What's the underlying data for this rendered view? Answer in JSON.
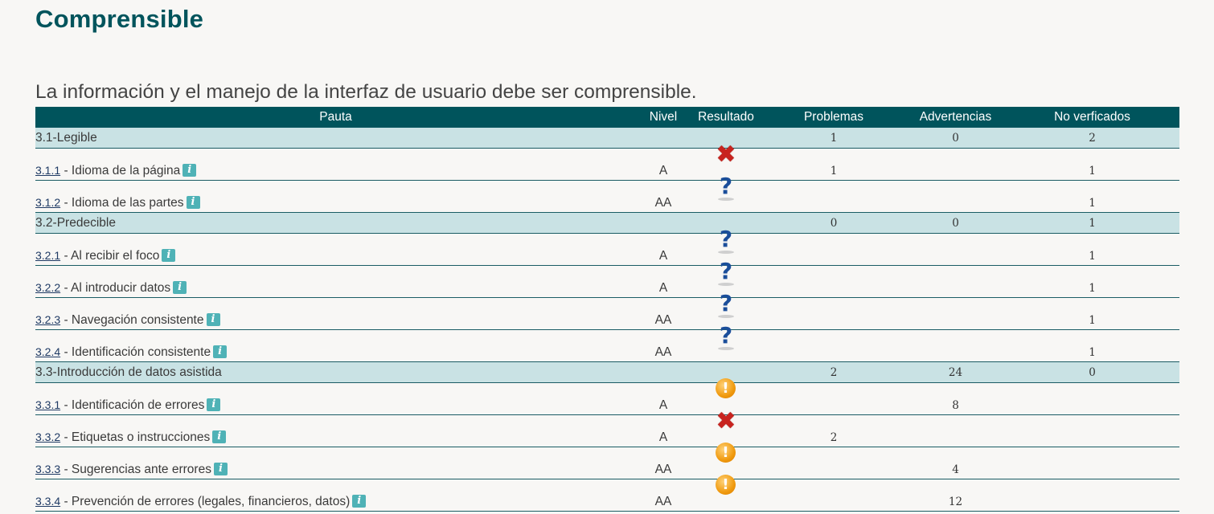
{
  "section_title": "Comprensible",
  "section_description": "La información y el manejo de la interfaz de usuario debe ser comprensible.",
  "table": {
    "headers": {
      "pauta": "Pauta",
      "nivel": "Nivel",
      "resultado": "Resultado",
      "problemas": "Problemas",
      "advertencias": "Advertencias",
      "no_verificados": "No verficados"
    },
    "groups": [
      {
        "label": "3.1-Legible",
        "problemas": "1",
        "advertencias": "0",
        "no_verificados": "2",
        "items": [
          {
            "code": "3.1.1",
            "label": " - Idioma de la página",
            "nivel": "A",
            "result_icon": "fail",
            "problemas": "1",
            "advertencias": "",
            "no_verificados": "1"
          },
          {
            "code": "3.1.2",
            "label": " - Idioma de las partes",
            "nivel": "AA",
            "result_icon": "unknown",
            "problemas": "",
            "advertencias": "",
            "no_verificados": "1"
          }
        ]
      },
      {
        "label": "3.2-Predecible",
        "problemas": "0",
        "advertencias": "0",
        "no_verificados": "1",
        "items": [
          {
            "code": "3.2.1",
            "label": " - Al recibir el foco",
            "nivel": "A",
            "result_icon": "unknown",
            "problemas": "",
            "advertencias": "",
            "no_verificados": "1"
          },
          {
            "code": "3.2.2",
            "label": " - Al introducir datos",
            "nivel": "A",
            "result_icon": "unknown",
            "problemas": "",
            "advertencias": "",
            "no_verificados": "1"
          },
          {
            "code": "3.2.3",
            "label": " - Navegación consistente",
            "nivel": "AA",
            "result_icon": "unknown",
            "problemas": "",
            "advertencias": "",
            "no_verificados": "1"
          },
          {
            "code": "3.2.4",
            "label": " - Identificación consistente",
            "nivel": "AA",
            "result_icon": "unknown",
            "problemas": "",
            "advertencias": "",
            "no_verificados": "1"
          }
        ]
      },
      {
        "label": "3.3-Introducción de datos asistida",
        "problemas": "2",
        "advertencias": "24",
        "no_verificados": "0",
        "items": [
          {
            "code": "3.3.1",
            "label": " - Identificación de errores",
            "nivel": "A",
            "result_icon": "warning",
            "problemas": "",
            "advertencias": "8",
            "no_verificados": ""
          },
          {
            "code": "3.3.2",
            "label": " - Etiquetas o instrucciones",
            "nivel": "A",
            "result_icon": "fail",
            "problemas": "2",
            "advertencias": "",
            "no_verificados": ""
          },
          {
            "code": "3.3.3",
            "label": " - Sugerencias ante errores",
            "nivel": "AA",
            "result_icon": "warning",
            "problemas": "",
            "advertencias": "4",
            "no_verificados": ""
          },
          {
            "code": "3.3.4",
            "label": " - Prevención de errores (legales, financieros, datos)",
            "nivel": "AA",
            "result_icon": "warning",
            "problemas": "",
            "advertencias": "12",
            "no_verificados": ""
          }
        ]
      }
    ]
  },
  "icon_glyphs": {
    "info": "i",
    "fail": "✖",
    "unknown": "?",
    "warning": "!"
  },
  "colors": {
    "title": "#00545c",
    "header_bg": "#00545c",
    "group_bg": "#c9e2e4",
    "info_icon": "#4fb2b6",
    "fail": "#c8231e",
    "unknown": "#1b4e9a",
    "warning": "#f09a0e"
  }
}
